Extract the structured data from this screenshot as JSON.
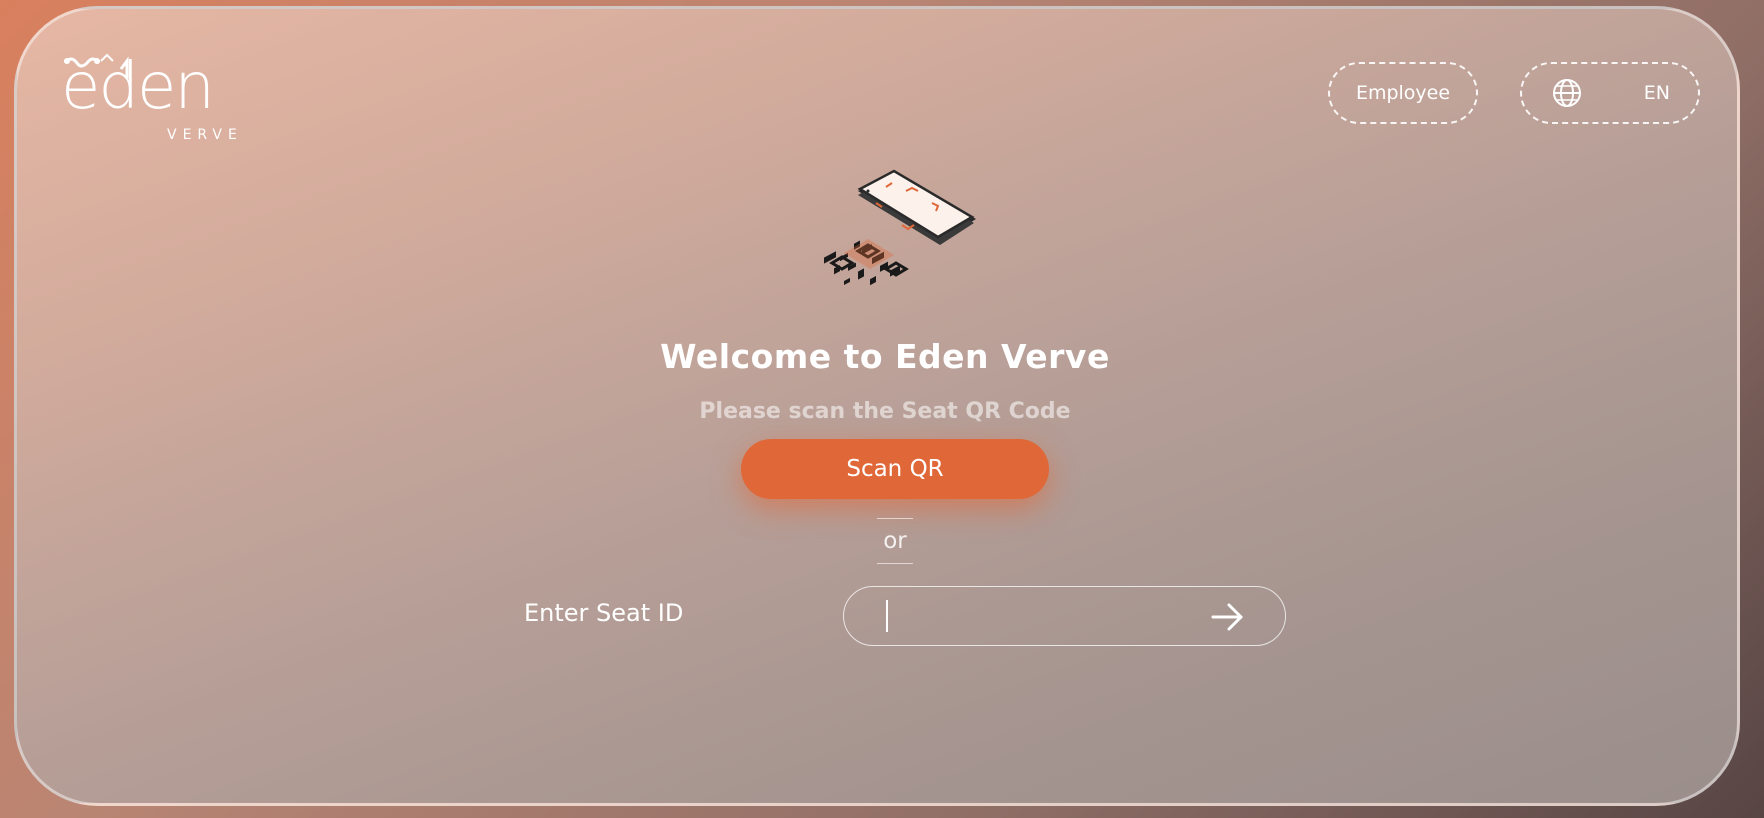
{
  "brand": {
    "name": "eden",
    "sub": "VERVE",
    "logo_icon": "eden-verve-logo"
  },
  "header": {
    "employee_label": "Employee",
    "language_label": "EN",
    "language_icon": "globe-icon"
  },
  "main": {
    "illustration": "phone-scanning-qr-illustration",
    "title": "Welcome to Eden Verve",
    "subtitle": "Please scan the Seat QR Code",
    "scan_button_label": "Scan QR",
    "divider_text": "or",
    "seat_label": "Enter Seat ID",
    "seat_input_value": "",
    "seat_input_placeholder": "",
    "submit_icon": "arrow-right-icon"
  },
  "colors": {
    "accent": "#e06737",
    "text": "#ffffff"
  }
}
